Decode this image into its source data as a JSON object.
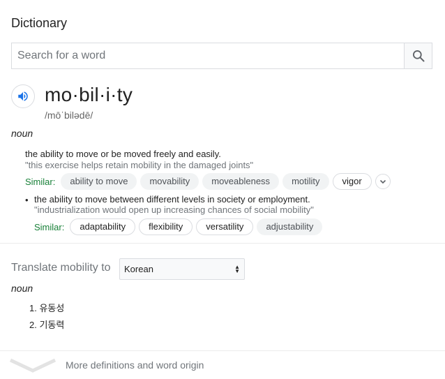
{
  "header": {
    "title": "Dictionary"
  },
  "search": {
    "placeholder": "Search for a word",
    "value": ""
  },
  "entry": {
    "word": "mo·bil·i·ty",
    "phonetic": "/mōˈbilədē/",
    "part_of_speech": "noun",
    "senses": [
      {
        "definition": "the ability to move or be moved freely and easily.",
        "example": "\"this exercise helps retain mobility in the damaged joints\"",
        "similar_label": "Similar:",
        "similar": [
          "ability to move",
          "movability",
          "moveableness",
          "motility",
          "vigor"
        ]
      },
      {
        "bullet": "•",
        "definition": "the ability to move between different levels in society or employment.",
        "example": "\"industrialization would open up increasing chances of social mobility\"",
        "similar_label": "Similar:",
        "similar": [
          "adaptability",
          "flexibility",
          "versatility",
          "adjustability"
        ]
      }
    ]
  },
  "translate": {
    "label": "Translate mobility to",
    "language": "Korean",
    "part_of_speech": "noun",
    "results": [
      "1. 유동성",
      "2. 기동력"
    ]
  },
  "footer": {
    "more_label": "More definitions and word origin"
  },
  "colors": {
    "similar_green": "#188038",
    "speaker_blue": "#1a73e8",
    "chip_bg": "#f1f3f4"
  }
}
